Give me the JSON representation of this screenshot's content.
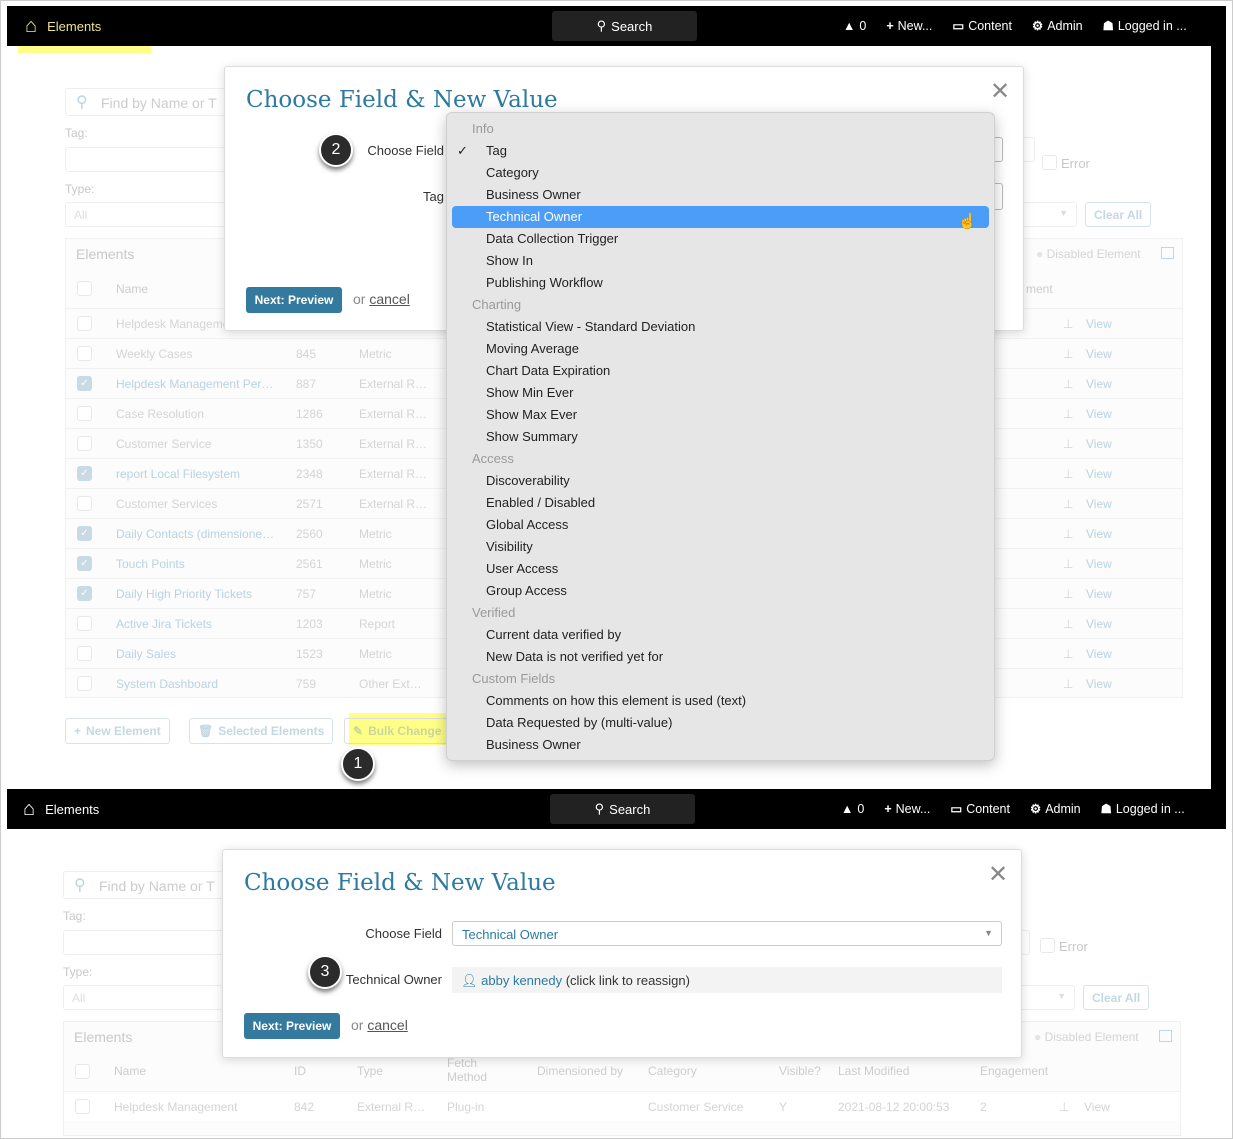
{
  "nav": {
    "title": "Elements",
    "search": "Search",
    "alerts": "0",
    "new": "New...",
    "content": "Content",
    "admin": "Admin",
    "user": "Logged in ..."
  },
  "filters": {
    "search_placeholder": "Find by Name or T",
    "tag_label": "Tag:",
    "type_label": "Type:",
    "type_value": "All",
    "error_label": "Error",
    "clear_all": "Clear All"
  },
  "elements": {
    "title": "Elements",
    "legend": "Disabled Element",
    "view": "View",
    "partial_col": "ment",
    "columns": {
      "name": "Name",
      "id": "ID",
      "type": "Type",
      "fetch": "Fetch Method",
      "dimensioned": "Dimensioned by",
      "category": "Category",
      "visible": "Visible?",
      "modified": "Last Modified",
      "engagement": "Engagement"
    },
    "rows": [
      {
        "name": "Helpdesk Management",
        "id": "",
        "type": "",
        "checked": false,
        "link": false
      },
      {
        "name": "Weekly Cases",
        "id": "845",
        "type": "Metric",
        "checked": false,
        "link": false
      },
      {
        "name": "Helpdesk Management Per…",
        "id": "887",
        "type": "External R…",
        "checked": true,
        "link": true
      },
      {
        "name": "Case Resolution",
        "id": "1286",
        "type": "External R…",
        "checked": false,
        "link": false
      },
      {
        "name": "Customer Service",
        "id": "1350",
        "type": "External R…",
        "checked": false,
        "link": false
      },
      {
        "name": "report Local Filesystem",
        "id": "2348",
        "type": "External R…",
        "checked": true,
        "link": true
      },
      {
        "name": "Customer Services",
        "id": "2571",
        "type": "External R…",
        "checked": false,
        "link": false
      },
      {
        "name": "Daily Contacts (dimensione…",
        "id": "2560",
        "type": "Metric",
        "checked": true,
        "link": true
      },
      {
        "name": "Touch Points",
        "id": "2561",
        "type": "Metric",
        "checked": true,
        "link": true
      },
      {
        "name": "Daily High Priority Tickets",
        "id": "757",
        "type": "Metric",
        "checked": true,
        "link": true
      },
      {
        "name": "Active Jira Tickets",
        "id": "1203",
        "type": "Report",
        "checked": false,
        "link": true
      },
      {
        "name": "Daily Sales",
        "id": "1523",
        "type": "Metric",
        "checked": false,
        "link": true
      },
      {
        "name": "System Dashboard",
        "id": "759",
        "type": "Other Ext…",
        "checked": false,
        "link": true
      }
    ],
    "bottom_row": {
      "name": "Helpdesk Management",
      "id": "842",
      "type": "External R…",
      "fetch": "Plug-in",
      "category": "Customer Service",
      "visible": "Y",
      "modified": "2021-08-12 20:00:53",
      "engagement": "2"
    }
  },
  "actions": {
    "new_element": "New Element",
    "selected_elements": "Selected Elements",
    "bulk_change": "Bulk Change"
  },
  "modal": {
    "title": "Choose Field & New Value",
    "choose_field_label": "Choose Field",
    "tag_label": "Tag",
    "next": "Next: Preview",
    "or": "or",
    "cancel": "cancel",
    "selected_field": "Technical Owner",
    "owner_label": "Technical Owner",
    "owner_name": "abby kennedy",
    "owner_hint": "(click link to reassign)"
  },
  "dropdown": [
    {
      "label": "Info",
      "group": true
    },
    {
      "label": "Tag",
      "checked": true
    },
    {
      "label": "Category"
    },
    {
      "label": "Business Owner"
    },
    {
      "label": "Technical Owner",
      "highlighted": true
    },
    {
      "label": "Data Collection Trigger"
    },
    {
      "label": "Show In"
    },
    {
      "label": "Publishing Workflow"
    },
    {
      "label": "Charting",
      "group": true
    },
    {
      "label": "Statistical View - Standard Deviation"
    },
    {
      "label": "Moving Average"
    },
    {
      "label": "Chart Data Expiration"
    },
    {
      "label": "Show Min Ever"
    },
    {
      "label": "Show Max Ever"
    },
    {
      "label": "Show Summary"
    },
    {
      "label": "Access",
      "group": true
    },
    {
      "label": "Discoverability"
    },
    {
      "label": "Enabled / Disabled"
    },
    {
      "label": "Global Access"
    },
    {
      "label": "Visibility"
    },
    {
      "label": "User Access"
    },
    {
      "label": "Group Access"
    },
    {
      "label": "Verified",
      "group": true
    },
    {
      "label": "Current data verified by"
    },
    {
      "label": "New Data is not verified yet for"
    },
    {
      "label": "Custom Fields",
      "group": true
    },
    {
      "label": "Comments on how this element is used (text)"
    },
    {
      "label": "Data Requested by (multi-value)"
    },
    {
      "label": "Business Owner"
    }
  ],
  "badges": {
    "one": "1",
    "two": "2",
    "three": "3"
  },
  "colors": {
    "accent": "#337a9e",
    "highlight": "#4c9df7",
    "title": "#2c7aa0",
    "marker": "#ffff88"
  }
}
